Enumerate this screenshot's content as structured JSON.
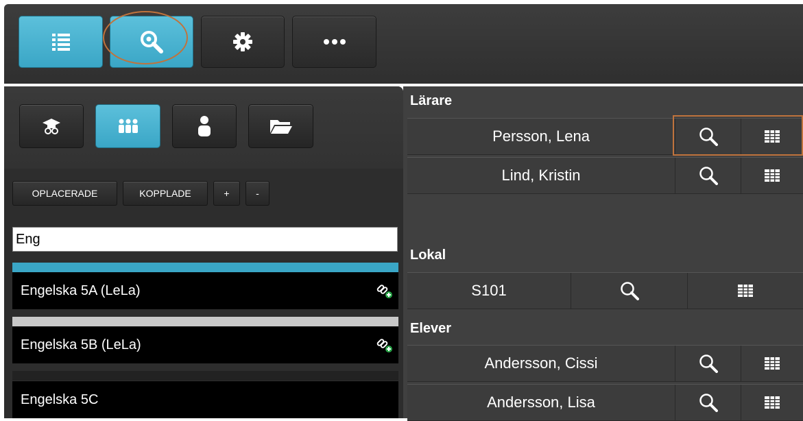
{
  "toolbar": {
    "buttons": [
      {
        "icon": "list-icon",
        "active": true
      },
      {
        "icon": "search-eye-icon",
        "active": true
      },
      {
        "icon": "gear-icon",
        "active": false
      },
      {
        "icon": "more-icon",
        "active": false
      }
    ]
  },
  "panel_tabs": [
    {
      "icon": "graduation-cap-icon",
      "active": false
    },
    {
      "icon": "group-icon",
      "active": true
    },
    {
      "icon": "person-icon",
      "active": false
    },
    {
      "icon": "folder-icon",
      "active": false
    }
  ],
  "filters": {
    "unplaced_label": "OPLACERADE",
    "linked_label": "KOPPLADE",
    "plus_label": "+",
    "minus_label": "-"
  },
  "search": {
    "value": "Eng"
  },
  "courses": [
    {
      "name": "Engelska 5A (LeLa)",
      "color": "#3aa6c6",
      "linked": true
    },
    {
      "name": "Engelska 5B (LeLa)",
      "color": "#c8c8c8",
      "linked": true
    },
    {
      "name": "Engelska 5C",
      "color": "#222222",
      "linked": false
    }
  ],
  "sections": {
    "teachers_title": "Lärare",
    "room_title": "Lokal",
    "students_title": "Elever"
  },
  "teachers": [
    {
      "name": "Persson, Lena"
    },
    {
      "name": "Lind, Kristin"
    }
  ],
  "rooms": [
    {
      "name": "S101"
    }
  ],
  "students": [
    {
      "name": "Andersson, Cissi"
    },
    {
      "name": "Andersson, Lisa"
    }
  ],
  "colors": {
    "accent": "#3aa6c6",
    "annotation": "#c0733c"
  }
}
